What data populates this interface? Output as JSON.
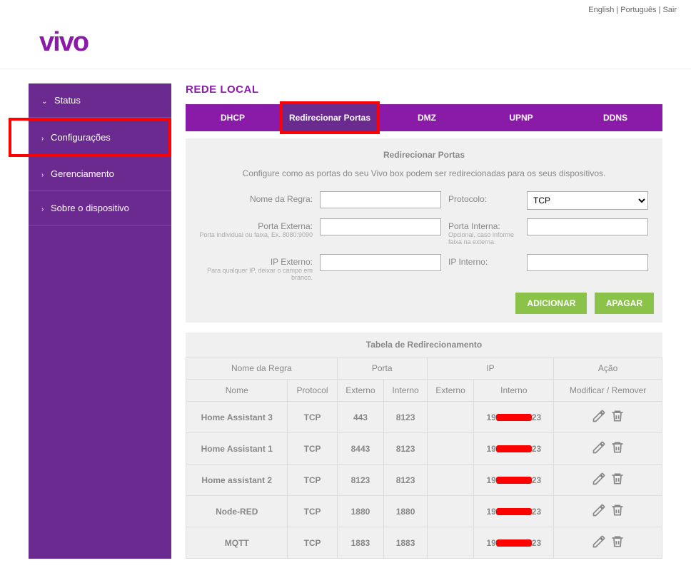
{
  "top_links": {
    "english": "English",
    "portugues": "Português",
    "sair": "Sair"
  },
  "logo": "vivo",
  "sidebar": {
    "items": [
      {
        "label": "Status"
      },
      {
        "label": "Configurações"
      },
      {
        "label": "Gerenciamento"
      },
      {
        "label": "Sobre o dispositivo"
      }
    ]
  },
  "page_title": "REDE LOCAL",
  "tabs": [
    {
      "label": "DHCP"
    },
    {
      "label": "Redirecionar Portas"
    },
    {
      "label": "DMZ"
    },
    {
      "label": "UPNP"
    },
    {
      "label": "DDNS"
    }
  ],
  "panel": {
    "title": "Redirecionar Portas",
    "desc": "Configure como as portas do seu Vivo box podem ser redirecionadas para os seus dispositivos.",
    "fields": {
      "nome_regra": "Nome da Regra:",
      "protocolo": "Protocolo:",
      "protocolo_value": "TCP",
      "porta_externa": "Porta Externa:",
      "porta_externa_sub": "Porta individual ou faixa, Ex. 8080:9090",
      "porta_interna": "Porta Interna:",
      "porta_interna_sub": "Opcional, caso informe faixa na externa.",
      "ip_externo": "IP Externo:",
      "ip_externo_sub": "Para qualquer IP, deixar o campo em branco.",
      "ip_interno": "IP Interno:"
    },
    "btn_add": "ADICIONAR",
    "btn_clear": "APAGAR"
  },
  "table": {
    "title": "Tabela de Redirecionamento",
    "head": {
      "nome_regra": "Nome da Regra",
      "porta": "Porta",
      "ip": "IP",
      "acao": "Ação",
      "nome": "Nome",
      "protocol": "Protocol",
      "externo": "Externo",
      "interno": "Interno",
      "mod_rem": "Modificar / Remover"
    },
    "rows": [
      {
        "nome": "Home Assistant 3",
        "protocol": "TCP",
        "ext": "443",
        "int": "8123",
        "ip_ext": "",
        "ip_int_pre": "19",
        "ip_int_post": "23"
      },
      {
        "nome": "Home Assistant 1",
        "protocol": "TCP",
        "ext": "8443",
        "int": "8123",
        "ip_ext": "",
        "ip_int_pre": "19",
        "ip_int_post": "23"
      },
      {
        "nome": "Home assistant 2",
        "protocol": "TCP",
        "ext": "8123",
        "int": "8123",
        "ip_ext": "",
        "ip_int_pre": "19",
        "ip_int_post": "23"
      },
      {
        "nome": "Node-RED",
        "protocol": "TCP",
        "ext": "1880",
        "int": "1880",
        "ip_ext": "",
        "ip_int_pre": "19",
        "ip_int_post": "23"
      },
      {
        "nome": "MQTT",
        "protocol": "TCP",
        "ext": "1883",
        "int": "1883",
        "ip_ext": "",
        "ip_int_pre": "19",
        "ip_int_post": "23"
      }
    ]
  }
}
